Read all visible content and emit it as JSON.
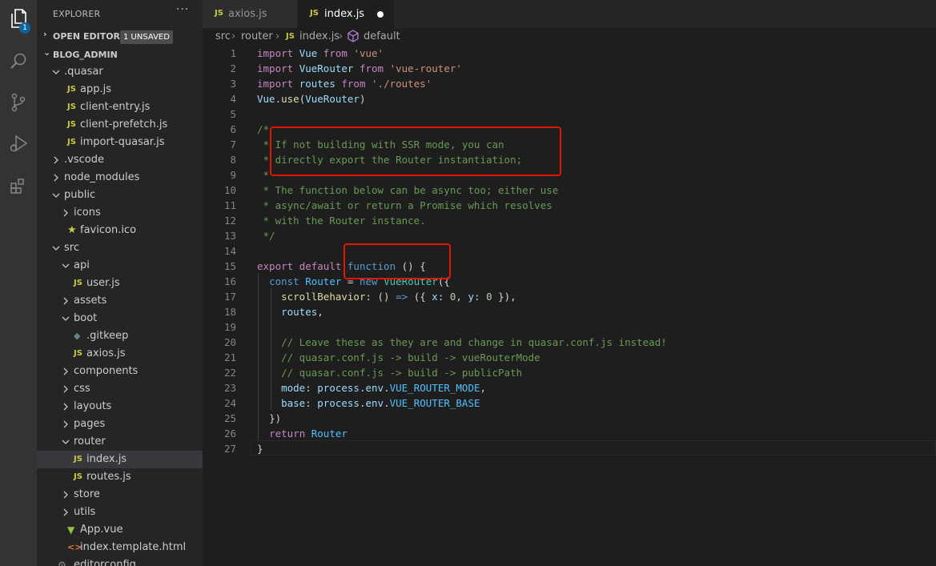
{
  "activity_bar": {
    "explorer_badge": "1",
    "icons": [
      "files-icon",
      "search-icon",
      "source-control-icon",
      "run-debug-icon",
      "extensions-icon"
    ]
  },
  "sidebar": {
    "title": "EXPLORER",
    "more": "···",
    "open_editors": {
      "label": "OPEN EDITORS",
      "badge": "1 UNSAVED"
    },
    "project": {
      "label": "BLOG_ADMIN"
    },
    "tree": [
      {
        "name": ".quasar",
        "type": "folder",
        "open": true
      },
      {
        "name": "app.js",
        "type": "js"
      },
      {
        "name": "client-entry.js",
        "type": "js"
      },
      {
        "name": "client-prefetch.js",
        "type": "js"
      },
      {
        "name": "import-quasar.js",
        "type": "js"
      },
      {
        "name": ".vscode",
        "type": "folder",
        "open": false
      },
      {
        "name": "node_modules",
        "type": "folder",
        "open": false
      },
      {
        "name": "public",
        "type": "folder",
        "open": true
      },
      {
        "name": "icons",
        "type": "folder",
        "open": false
      },
      {
        "name": "favicon.ico",
        "type": "star"
      },
      {
        "name": "src",
        "type": "folder",
        "open": true
      },
      {
        "name": "api",
        "type": "folder",
        "open": true
      },
      {
        "name": "user.js",
        "type": "js"
      },
      {
        "name": "assets",
        "type": "folder",
        "open": false
      },
      {
        "name": "boot",
        "type": "folder",
        "open": true
      },
      {
        "name": ".gitkeep",
        "type": "diamond"
      },
      {
        "name": "axios.js",
        "type": "js"
      },
      {
        "name": "components",
        "type": "folder",
        "open": false
      },
      {
        "name": "css",
        "type": "folder",
        "open": false
      },
      {
        "name": "layouts",
        "type": "folder",
        "open": false
      },
      {
        "name": "pages",
        "type": "folder",
        "open": false
      },
      {
        "name": "router",
        "type": "folder",
        "open": true
      },
      {
        "name": "index.js",
        "type": "js",
        "selected": true
      },
      {
        "name": "routes.js",
        "type": "js"
      },
      {
        "name": "store",
        "type": "folder",
        "open": false
      },
      {
        "name": "utils",
        "type": "folder",
        "open": false
      },
      {
        "name": "App.vue",
        "type": "vue"
      },
      {
        "name": "index.template.html",
        "type": "html"
      },
      {
        "name": ".editorconfig",
        "type": "gear"
      }
    ]
  },
  "tabs": [
    {
      "icon": "JS",
      "label": "axios.js",
      "active": false
    },
    {
      "icon": "JS",
      "label": "index.js",
      "active": true,
      "dirty": true
    }
  ],
  "breadcrumbs": [
    "src",
    "router",
    "index.js",
    "default"
  ],
  "line_numbers": [
    "1",
    "2",
    "3",
    "4",
    "5",
    "6",
    "7",
    "8",
    "9",
    "10",
    "11",
    "12",
    "13",
    "14",
    "15",
    "16",
    "17",
    "18",
    "19",
    "20",
    "21",
    "22",
    "23",
    "24",
    "25",
    "26",
    "27"
  ],
  "code": {
    "l1": {
      "kw": "import",
      "id": "Vue",
      "from": "from",
      "str": "'vue'"
    },
    "l2": {
      "kw": "import",
      "id": "VueRouter",
      "from": "from",
      "str": "'vue-router'"
    },
    "l3": {
      "kw": "import",
      "id": "routes",
      "from": "from",
      "str": "'./routes'"
    },
    "l4": {
      "obj": "Vue",
      "dot": ".",
      "method": "use",
      "open": "(",
      "arg": "VueRouter",
      "close": ")"
    },
    "l6": "/*",
    "l7": " * If not building with SSR mode, you can",
    "l8": " * directly export the Router instantiation;",
    "l9": " *",
    "l10": " * The function below can be async too; either use",
    "l11": " * async/await or return a Promise which resolves",
    "l12": " * with the Router instance.",
    "l13": " */",
    "l15": {
      "export": "export",
      "default": "default",
      "function": "function",
      "rest": " () {"
    },
    "l16": {
      "const": "const",
      "name": "Router",
      "eq": " = ",
      "new": "new",
      "cls": "VueRouter",
      "rest": "({"
    },
    "l17": {
      "prop": "scrollBehavior",
      "colon": ": () ",
      "arrow": "=>",
      "p1": " ({ ",
      "x": "x",
      "c1": ": ",
      "n1": "0",
      "comma": ", ",
      "y": "y",
      "c2": ": ",
      "n2": "0",
      "end": " }),"
    },
    "l18": {
      "prop": "routes",
      "end": ","
    },
    "l20": "// Leave these as they are and change in quasar.conf.js instead!",
    "l21": "// quasar.conf.js -> build -> vueRouterMode",
    "l22": "// quasar.conf.js -> build -> publicPath",
    "l23": {
      "prop": "mode",
      "c": ": ",
      "obj": "process",
      "d1": ".",
      "env": "env",
      "d2": ".",
      "const": "VUE_ROUTER_MODE",
      "end": ","
    },
    "l24": {
      "prop": "base",
      "c": ": ",
      "obj": "process",
      "d1": ".",
      "env": "env",
      "d2": ".",
      "const": "VUE_ROUTER_BASE"
    },
    "l25": "})",
    "l26": {
      "kw": "return",
      "name": "Router"
    },
    "l27": "}"
  },
  "colors": {
    "highlight_box": "#e51400",
    "selected_row": "#37373d",
    "badge": "#0e639c"
  }
}
